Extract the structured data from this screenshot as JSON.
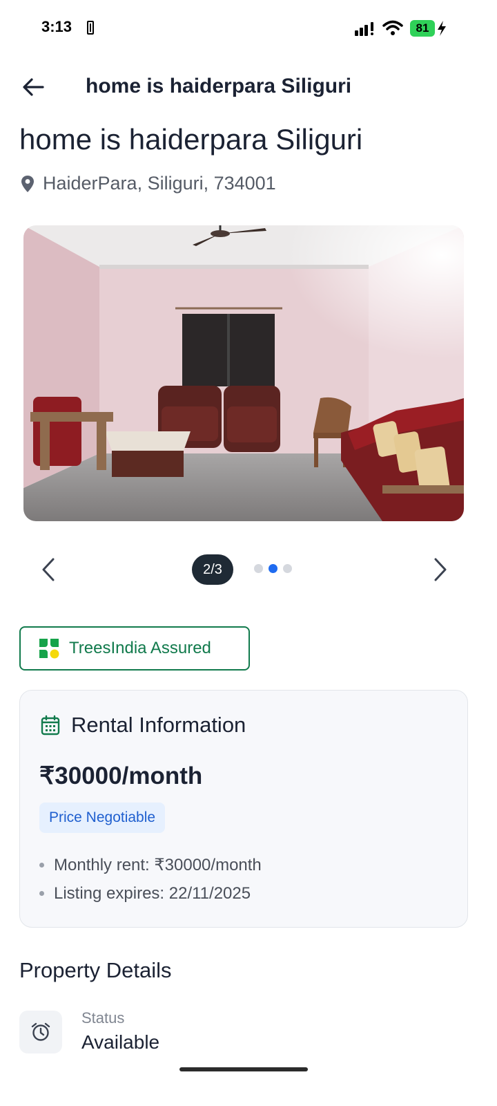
{
  "status_bar": {
    "time": "3:13",
    "battery_level": "81"
  },
  "header": {
    "title": "home is haiderpara Siliguri"
  },
  "listing": {
    "title": "home is haiderpara Siliguri",
    "location": "HaiderPara, Siliguri, 734001"
  },
  "carousel": {
    "counter": "2/3",
    "current_index": 2,
    "total": 3
  },
  "assured_badge": {
    "label": "TreesIndia Assured"
  },
  "rental": {
    "title": "Rental Information",
    "price": "₹30000/month",
    "negotiable_label": "Price Negotiable",
    "details": [
      "Monthly rent: ₹30000/month",
      "Listing expires: 22/11/2025"
    ]
  },
  "property_details": {
    "title": "Property Details",
    "status_label": "Status",
    "status_value": "Available"
  },
  "colors": {
    "accent_green": "#117a4c",
    "accent_blue": "#1f6bf0",
    "badge_blue_bg": "#e6f0fe",
    "battery_green": "#2fd158",
    "counter_dark": "#1f2a35"
  },
  "icons": {
    "back": "arrow-left-icon",
    "location": "map-pin-icon",
    "prev": "chevron-left-icon",
    "next": "chevron-right-icon",
    "assured": "treesindia-logo-icon",
    "rental": "calendar-icon",
    "status": "alarm-clock-icon"
  }
}
